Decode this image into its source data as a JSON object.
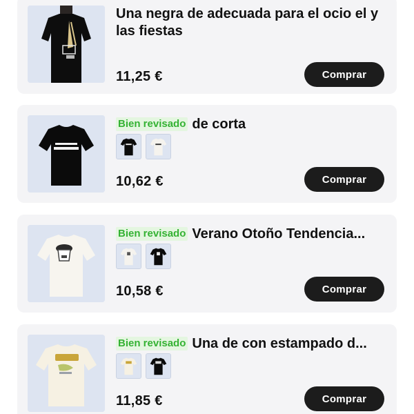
{
  "products": [
    {
      "title": "Una negra de adecuada para el ocio el y las fiestas",
      "badge": "",
      "price": "11,25 €",
      "buy_label": "Comprar",
      "image_icon": "black-tshirt-back-print-icon",
      "variants": []
    },
    {
      "title": "de corta",
      "badge": "Bien revisado",
      "price": "10,62 €",
      "buy_label": "Comprar",
      "image_icon": "black-tshirt-logo-icon",
      "variants": [
        "black-tshirt-icon",
        "white-tshirt-icon"
      ]
    },
    {
      "title": "Verano Otoño Tendencia...",
      "badge": "Bien revisado",
      "price": "10,58 €",
      "buy_label": "Comprar",
      "image_icon": "white-tshirt-graphic-icon",
      "variants": [
        "white-tshirt-icon",
        "black-tshirt-icon"
      ]
    },
    {
      "title": "Una de con estampado d...",
      "badge": "Bien revisado",
      "price": "11,85 €",
      "buy_label": "Comprar",
      "image_icon": "cream-tshirt-print-icon",
      "variants": [
        "cream-tshirt-icon",
        "black-tshirt-icon"
      ]
    }
  ],
  "colors": {
    "badge_text": "#34b233",
    "badge_bg": "#e4f6e0",
    "button_bg": "#1c1c1c",
    "card_bg": "#f4f4f6",
    "thumb_bg": "#d7e0f0"
  }
}
